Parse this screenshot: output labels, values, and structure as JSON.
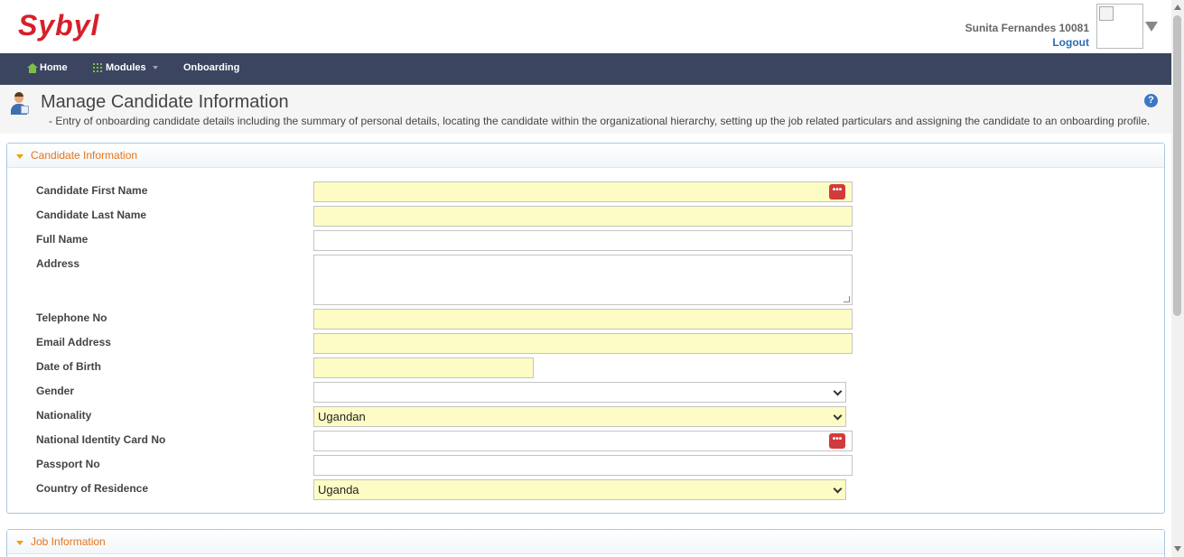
{
  "header": {
    "logo_text": "Sybyl",
    "user_name": "Sunita Fernandes  10081",
    "logout_label": "Logout"
  },
  "nav": {
    "home_label": "Home",
    "modules_label": "Modules",
    "onboarding_label": "Onboarding"
  },
  "page": {
    "title": "Manage Candidate Information",
    "subtitle": "- Entry of onboarding candidate details including the summary of personal details, locating the candidate within the organizational hierarchy, setting up the job related particulars and assigning the candidate to an onboarding profile.",
    "help_symbol": "?"
  },
  "candidate_panel": {
    "title": "Candidate Information",
    "fields": {
      "first_name": {
        "label": "Candidate First Name",
        "value": ""
      },
      "last_name": {
        "label": "Candidate Last Name",
        "value": ""
      },
      "full_name": {
        "label": "Full Name",
        "value": ""
      },
      "address": {
        "label": "Address",
        "value": ""
      },
      "telephone": {
        "label": "Telephone No",
        "value": ""
      },
      "email": {
        "label": "Email Address",
        "value": ""
      },
      "dob": {
        "label": "Date of Birth",
        "value": ""
      },
      "gender": {
        "label": "Gender",
        "value": ""
      },
      "nationality": {
        "label": "Nationality",
        "value": "Ugandan"
      },
      "nic": {
        "label": "National Identity Card No",
        "value": ""
      },
      "passport": {
        "label": "Passport No",
        "value": ""
      },
      "country": {
        "label": "Country of Residence",
        "value": "Uganda"
      }
    }
  },
  "job_panel": {
    "title": "Job Information"
  },
  "lookup_button_glyph": "•••",
  "colors": {
    "nav_bg": "#3b4560",
    "logo_red": "#d6202a",
    "required_field_bg": "#fdfcc4",
    "panel_title": "#e4741c",
    "link_blue": "#2a6db5"
  }
}
